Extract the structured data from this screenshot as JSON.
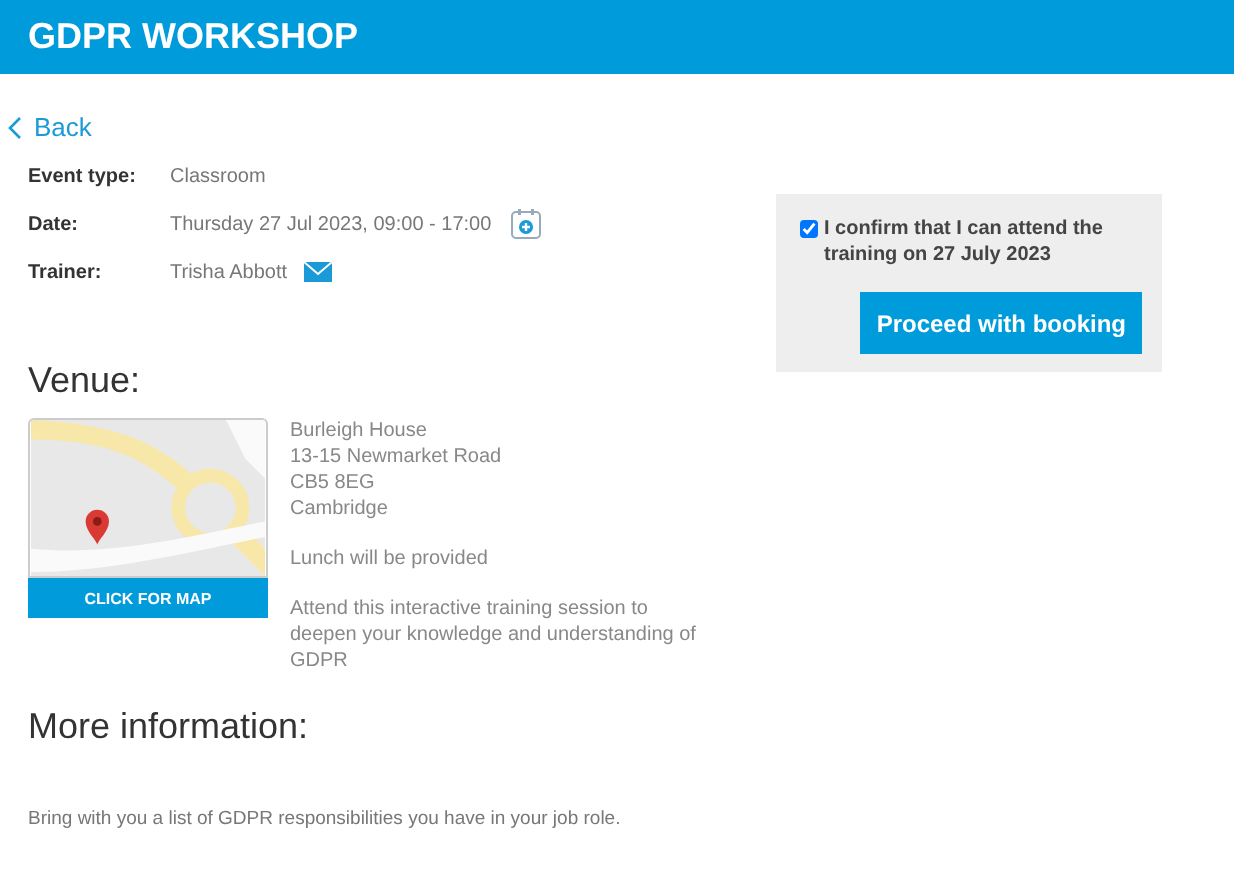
{
  "header": {
    "title": "GDPR WORKSHOP"
  },
  "back_link": "Back",
  "details": [
    {
      "kind": "text",
      "label": "Event type:",
      "value": "Classroom"
    },
    {
      "kind": "calendar",
      "label": "Date:",
      "value": "Thursday 27 Jul 2023, 09:00 - 17:00"
    },
    {
      "kind": "email",
      "label": "Trainer:",
      "value": "Trisha Abbott"
    }
  ],
  "booking": {
    "confirm": {
      "label": "I confirm that I can attend the training on 27 July 2023",
      "checked": true
    },
    "button": "Proceed with booking"
  },
  "venue": {
    "heading": "Venue:",
    "map": {
      "button": "CLICK FOR MAP"
    },
    "address": [
      "Burleigh House",
      "13-15 Newmarket Road",
      "CB5 8EG",
      "Cambridge"
    ],
    "note": "Lunch will be provided",
    "description": "Attend this interactive training session to deepen your knowledge and understanding of GDPR"
  },
  "more_info": {
    "heading": "More information:",
    "text": "Bring with you a list of GDPR responsibilities you have in your job role."
  }
}
